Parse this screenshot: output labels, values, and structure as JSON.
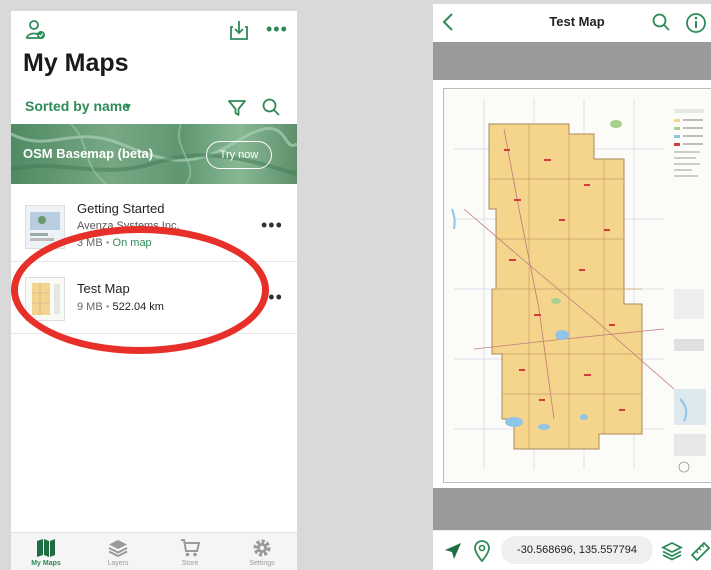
{
  "left": {
    "title": "My Maps",
    "sort_label": "Sorted by name",
    "banner": {
      "label": "OSM Basemap (beta)",
      "button": "Try now"
    },
    "items": [
      {
        "name": "Getting Started",
        "publisher": "Avenza Systems Inc.",
        "size": "3 MB",
        "status": "On map"
      },
      {
        "name": "Test Map",
        "size": "9 MB",
        "distance": "522.04 km"
      }
    ],
    "nav": [
      {
        "label": "My Maps",
        "icon": "map-icon",
        "active": true
      },
      {
        "label": "Layers",
        "icon": "layers-icon"
      },
      {
        "label": "Store",
        "icon": "cart-icon"
      },
      {
        "label": "Settings",
        "icon": "gear-icon"
      }
    ]
  },
  "right": {
    "title": "Test Map",
    "coordinates": "-30.568696, 135.557794"
  },
  "colors": {
    "accent": "#2e8b57",
    "highlight": "#e8302a",
    "map_fill": "#f5d48b"
  }
}
